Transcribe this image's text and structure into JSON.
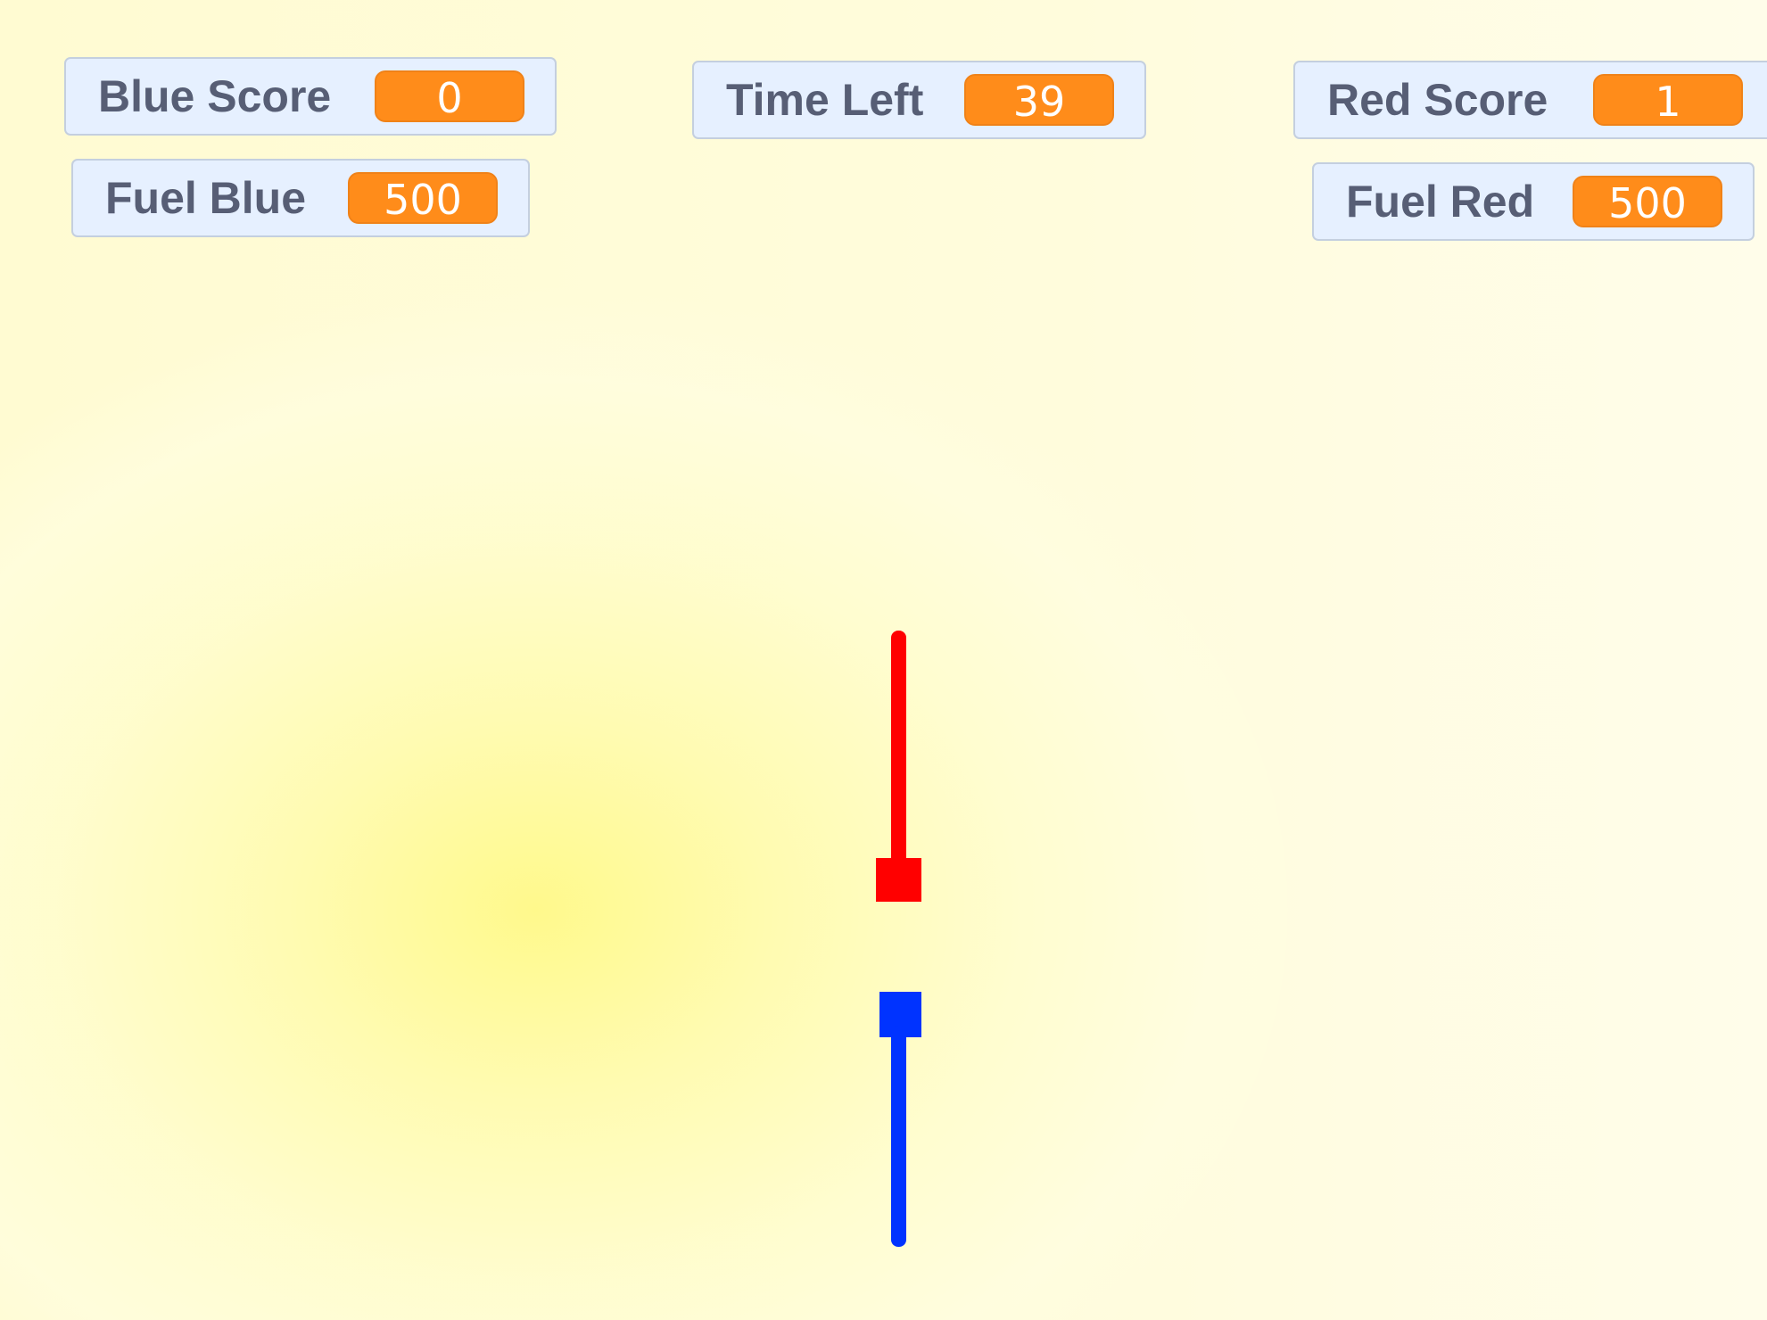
{
  "monitors": {
    "blue_score": {
      "label": "Blue Score",
      "value": "0"
    },
    "fuel_blue": {
      "label": "Fuel Blue",
      "value": "500"
    },
    "time_left": {
      "label": "Time Left",
      "value": "39"
    },
    "red_score": {
      "label": "Red Score",
      "value": "1"
    },
    "fuel_red": {
      "label": "Fuel Red",
      "value": "500"
    }
  },
  "colors": {
    "stage_background": "#fffbd2",
    "monitor_background": "#e6f0ff",
    "monitor_value": "#ff8c1a",
    "red_player": "#ff0000",
    "blue_player": "#0033ff"
  },
  "sprites": {
    "red_player": {
      "color": "red"
    },
    "blue_player": {
      "color": "blue"
    }
  }
}
